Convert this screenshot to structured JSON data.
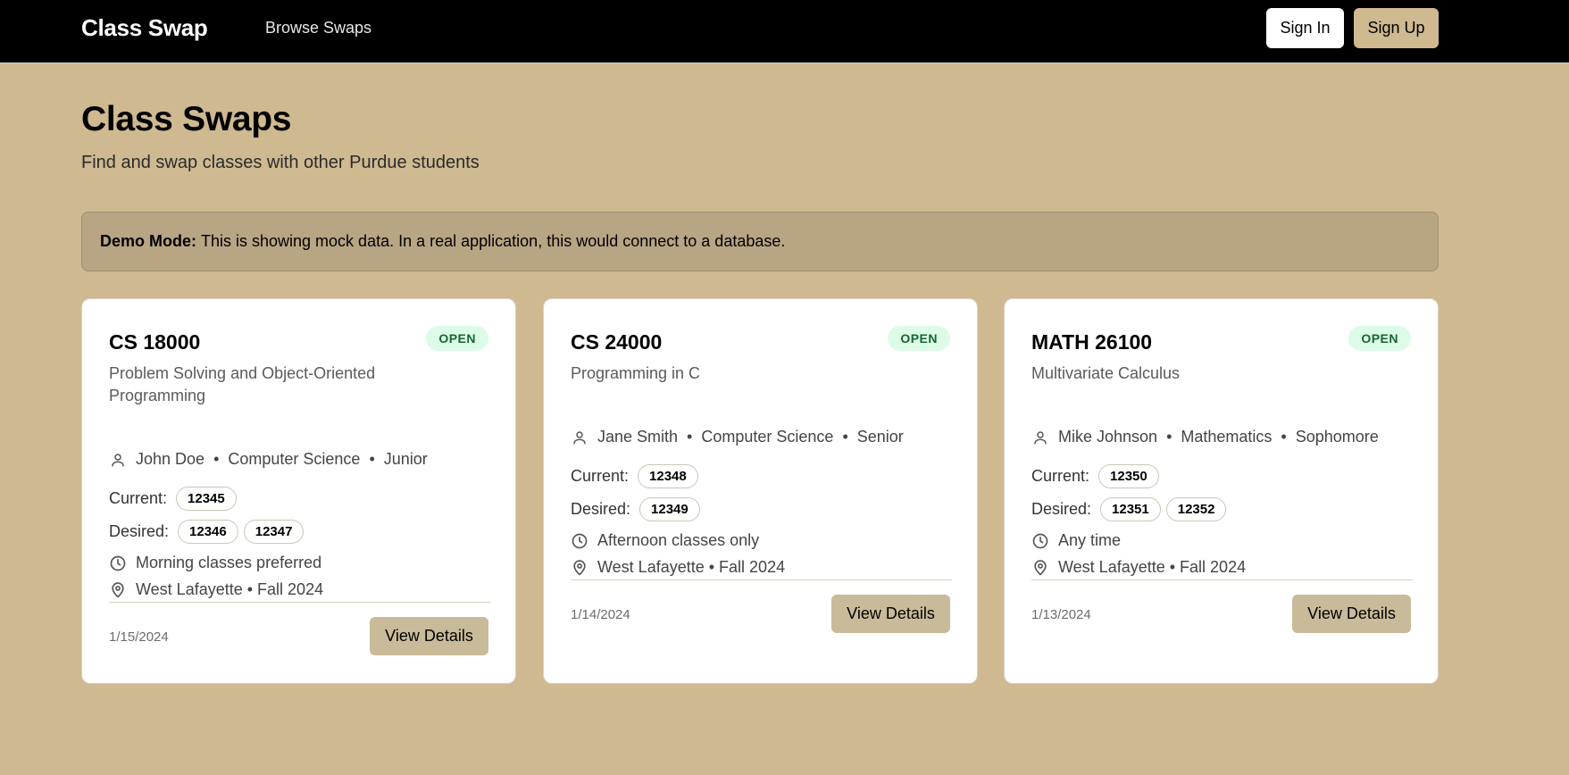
{
  "nav": {
    "brand": "Class Swap",
    "browse": "Browse Swaps",
    "sign_in": "Sign In",
    "sign_up": "Sign Up"
  },
  "header": {
    "title": "Class Swaps",
    "subtitle": "Find and swap classes with other Purdue students"
  },
  "banner": {
    "bold": "Demo Mode:",
    "text": "This is showing mock data. In a real application, this would connect to a database."
  },
  "labels": {
    "current": "Current:",
    "desired": "Desired:",
    "view_details": "View Details",
    "separator": "•"
  },
  "cards": [
    {
      "code": "CS 18000",
      "status": "OPEN",
      "name": "Problem Solving and Object-Oriented Programming",
      "student": "John Doe",
      "major": "Computer Science",
      "year": "Junior",
      "current": [
        "12345"
      ],
      "desired": [
        "12346",
        "12347"
      ],
      "preference": "Morning classes preferred",
      "location": "West Lafayette • Fall 2024",
      "date": "1/15/2024"
    },
    {
      "code": "CS 24000",
      "status": "OPEN",
      "name": "Programming in C",
      "student": "Jane Smith",
      "major": "Computer Science",
      "year": "Senior",
      "current": [
        "12348"
      ],
      "desired": [
        "12349"
      ],
      "preference": "Afternoon classes only",
      "location": "West Lafayette • Fall 2024",
      "date": "1/14/2024"
    },
    {
      "code": "MATH 26100",
      "status": "OPEN",
      "name": "Multivariate Calculus",
      "student": "Mike Johnson",
      "major": "Mathematics",
      "year": "Sophomore",
      "current": [
        "12350"
      ],
      "desired": [
        "12351",
        "12352"
      ],
      "preference": "Any time",
      "location": "West Lafayette • Fall 2024",
      "date": "1/13/2024"
    }
  ],
  "icons": {
    "student": "user-icon",
    "preference": "clock-icon",
    "location": "map-pin-icon"
  },
  "colors": {
    "background": "#CFB991",
    "navbar": "#000000",
    "banner": "#B8A584",
    "status_bg": "#DCFCE7",
    "status_text": "#166534",
    "button": "#C9BB99"
  }
}
